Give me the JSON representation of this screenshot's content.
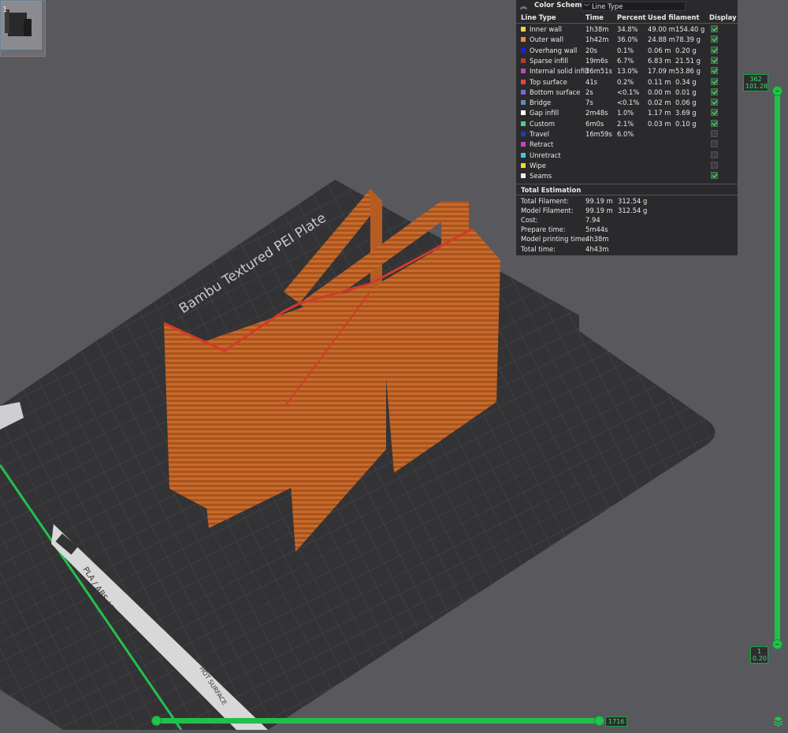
{
  "thumbnail": {
    "index": "1"
  },
  "plate": {
    "name": "Bambu Textured PEI Plate",
    "material_label": "PLA / ABS / PETG",
    "warning": "HOT SURFACE"
  },
  "legend": {
    "title": "Color Scheme",
    "scheme_value": "Line Type",
    "columns": {
      "line_type": "Line Type",
      "time": "Time",
      "percent": "Percent",
      "used": "Used filament",
      "display": "Display"
    },
    "rows": [
      {
        "label": "Inner wall",
        "color": "#f5d04a",
        "time": "1h38m",
        "percent": "34.8%",
        "length": "49.00 m",
        "weight": "154.40 g",
        "display": true
      },
      {
        "label": "Outer wall",
        "color": "#f08c3a",
        "time": "1h42m",
        "percent": "36.0%",
        "length": "24.88 m",
        "weight": "78.39 g",
        "display": true
      },
      {
        "label": "Overhang wall",
        "color": "#1f1fe0",
        "time": "20s",
        "percent": "0.1%",
        "length": "0.06 m",
        "weight": "0.20 g",
        "display": true
      },
      {
        "label": "Sparse infill",
        "color": "#b83a2a",
        "time": "19m6s",
        "percent": "6.7%",
        "length": "6.83 m",
        "weight": "21.51 g",
        "display": true
      },
      {
        "label": "Internal solid infill",
        "color": "#b44bc0",
        "time": "36m51s",
        "percent": "13.0%",
        "length": "17.09 m",
        "weight": "53.86 g",
        "display": true
      },
      {
        "label": "Top surface",
        "color": "#e8443a",
        "time": "41s",
        "percent": "0.2%",
        "length": "0.11 m",
        "weight": "0.34 g",
        "display": true
      },
      {
        "label": "Bottom surface",
        "color": "#7a6ad0",
        "time": "2s",
        "percent": "<0.1%",
        "length": "0.00 m",
        "weight": "0.01 g",
        "display": true
      },
      {
        "label": "Bridge",
        "color": "#5a8cc0",
        "time": "7s",
        "percent": "<0.1%",
        "length": "0.02 m",
        "weight": "0.06 g",
        "display": true
      },
      {
        "label": "Gap infill",
        "color": "#ffffff",
        "time": "2m48s",
        "percent": "1.0%",
        "length": "1.17 m",
        "weight": "3.69 g",
        "display": true
      },
      {
        "label": "Custom",
        "color": "#4ad08a",
        "time": "6m0s",
        "percent": "2.1%",
        "length": "0.03 m",
        "weight": "0.10 g",
        "display": true
      },
      {
        "label": "Travel",
        "color": "#2a3aa8",
        "time": "16m59s",
        "percent": "6.0%",
        "length": "",
        "weight": "",
        "display": false
      },
      {
        "label": "Retract",
        "color": "#d040c0",
        "time": "",
        "percent": "",
        "length": "",
        "weight": "",
        "display": false
      },
      {
        "label": "Unretract",
        "color": "#40c8e0",
        "time": "",
        "percent": "",
        "length": "",
        "weight": "",
        "display": false
      },
      {
        "label": "Wipe",
        "color": "#f0e020",
        "time": "",
        "percent": "",
        "length": "",
        "weight": "",
        "display": false
      },
      {
        "label": "Seams",
        "color": "#f0f0f0",
        "time": "",
        "percent": "",
        "length": "",
        "weight": "",
        "display": true
      }
    ],
    "estimation": {
      "title": "Total Estimation",
      "rows": [
        {
          "label": "Total Filament:",
          "v1": "99.19 m",
          "v2": "312.54 g"
        },
        {
          "label": "Model Filament:",
          "v1": "99.19 m",
          "v2": "312.54 g"
        },
        {
          "label": "Cost:",
          "v1": "7.94",
          "v2": ""
        },
        {
          "label": "Prepare time:",
          "v1": "5m44s",
          "v2": ""
        },
        {
          "label": "Model printing time:",
          "v1": "4h38m",
          "v2": ""
        },
        {
          "label": "Total time:",
          "v1": "4h43m",
          "v2": ""
        }
      ]
    }
  },
  "layer_slider": {
    "top_layer": "362",
    "top_height": "101.28",
    "bottom_layer": "1",
    "bottom_height": "0.20",
    "colors": {
      "track": "#20c04a",
      "label_text": "#3fe06b"
    }
  },
  "move_slider": {
    "value": "1716",
    "position_fraction": 1.0
  }
}
